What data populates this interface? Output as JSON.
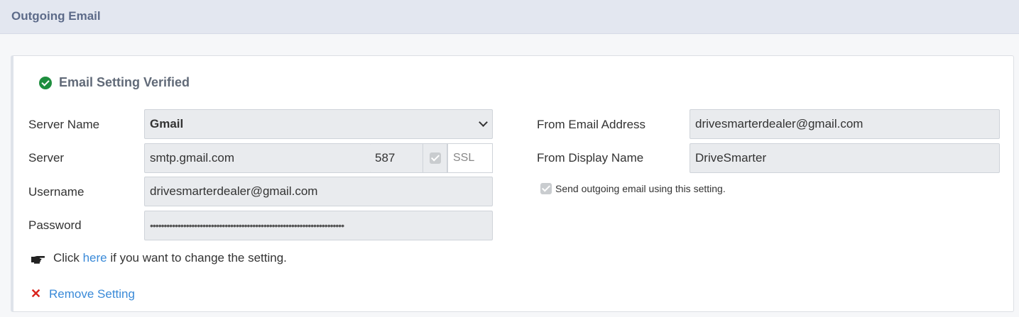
{
  "header": {
    "title": "Outgoing Email"
  },
  "status": {
    "label": "Email Setting Verified",
    "color": "#1e8e3e"
  },
  "form": {
    "server_name_label": "Server Name",
    "server_name_value": "Gmail",
    "server_label": "Server",
    "server_value": "smtp.gmail.com",
    "port_value": "587",
    "ssl_checked": true,
    "ssl_placeholder": "SSL",
    "username_label": "Username",
    "username_value": "drivesmarterdealer@gmail.com",
    "password_label": "Password",
    "password_value": "••••••••••••••••••••••••••••••••••••••••••••••••••••••••••••••••••••••",
    "from_email_label": "From Email Address",
    "from_email_value": "drivesmarterdealer@gmail.com",
    "from_display_label": "From Display Name",
    "from_display_value": "DriveSmarter",
    "send_checked": true,
    "send_label": "Send outgoing email using this setting."
  },
  "hint": {
    "prefix": "Click",
    "link": "here",
    "suffix": "if you want to change the setting."
  },
  "remove": {
    "label": "Remove Setting"
  },
  "colors": {
    "link": "#3a8ad8",
    "danger": "#d9231c",
    "header_bg": "#e3e7f0"
  }
}
